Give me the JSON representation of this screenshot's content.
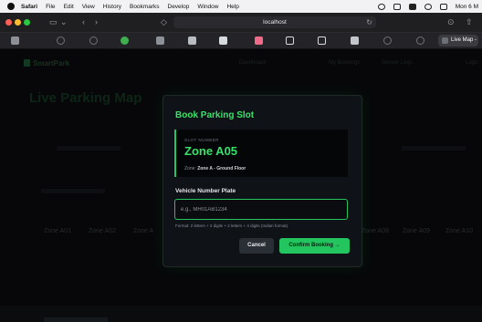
{
  "menubar": {
    "items": [
      "Safari",
      "File",
      "Edit",
      "View",
      "History",
      "Bookmarks",
      "Develop",
      "Window",
      "Help"
    ],
    "clock": "Mon 6 M"
  },
  "browser": {
    "url": "localhost",
    "active_tab_label": "Live Map -"
  },
  "app": {
    "brand": "SmartPark",
    "nav": [
      "Dashboard",
      "My Bookings",
      "Sensor Logs",
      "Logo"
    ],
    "page_title": "Live Parking Map",
    "zones_visible": [
      "Zone A01",
      "Zone A02",
      "Zone A",
      "Zone A08",
      "Zone A09",
      "Zone A10"
    ]
  },
  "modal": {
    "title": "Book Parking Slot",
    "slot_caption": "SLOT NUMBER",
    "slot_value": "Zone A05",
    "zone_prefix": "Zone:",
    "zone_value": "Zone A - Ground Floor",
    "field_label": "Vehicle Number Plate",
    "input_placeholder": "e.g., MH01AB1234",
    "input_value": "",
    "hint": "Format: 2 letters + 2 digits + 2 letters + 4 digits (Indian format)",
    "cancel_label": "Cancel",
    "confirm_label": "Confirm Booking →"
  },
  "colors": {
    "accent": "#22c55e",
    "title_green": "#39e36a",
    "background": "#0b0c0e"
  }
}
